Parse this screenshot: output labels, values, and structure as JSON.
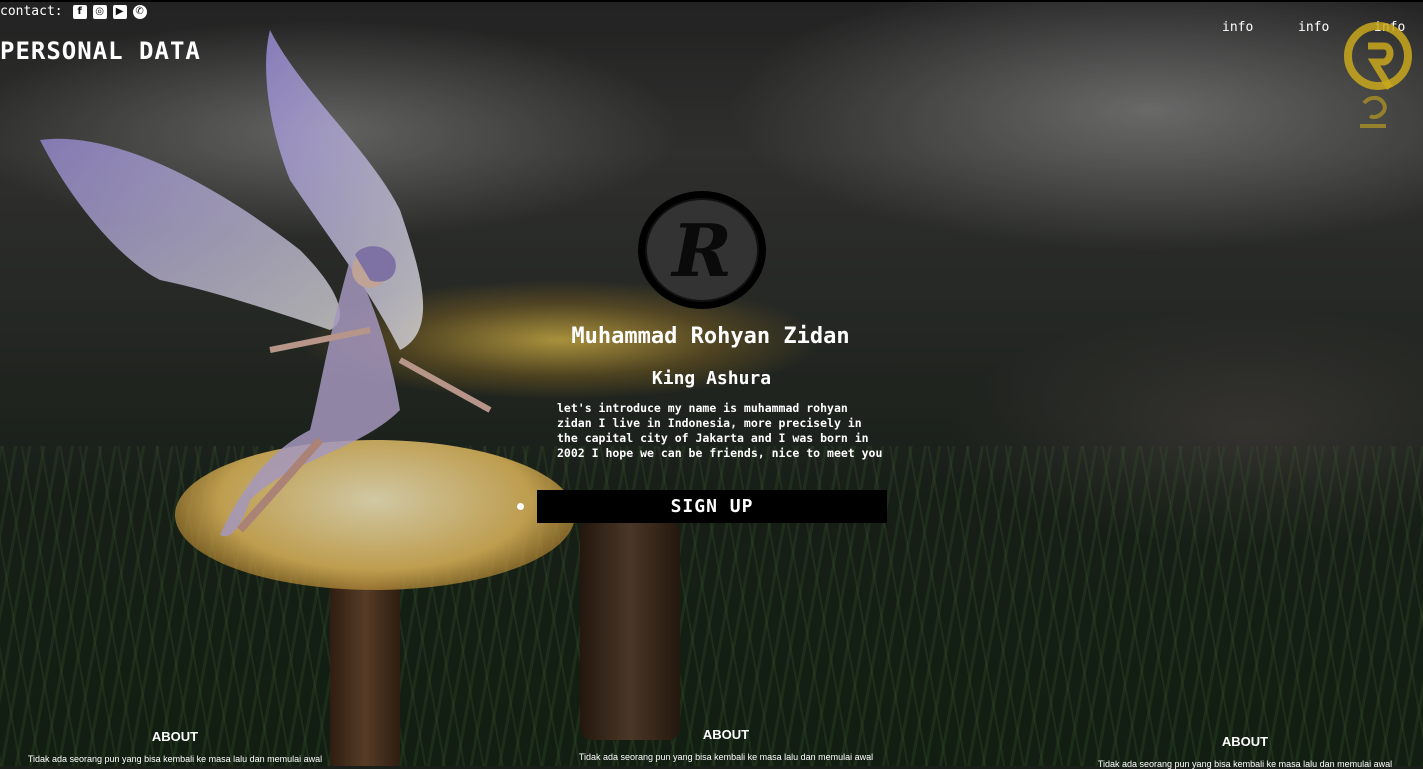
{
  "header": {
    "contact_label": "contact:",
    "social_icons": [
      {
        "name": "facebook-icon",
        "glyph": "f"
      },
      {
        "name": "instagram-icon",
        "glyph": "◎"
      },
      {
        "name": "youtube-icon",
        "glyph": "▶"
      },
      {
        "name": "whatsapp-icon",
        "glyph": "✆"
      }
    ],
    "site_title": "PERSONAL DATA",
    "nav": [
      "info",
      "info",
      "info"
    ]
  },
  "profile": {
    "name": "Muhammad Rohyan Zidan",
    "nickname": "King Ashura",
    "intro": "let's introduce my name is muhammad rohyan zidan I live in Indonesia, more precisely in the capital city of Jakarta and I was born in 2002 I hope we can be friends, nice to meet you",
    "signup_label": "SIGN UP",
    "avatar_letter": "R"
  },
  "about": [
    {
      "title": "ABOUT",
      "text": "Tidak ada seorang pun yang bisa kembali ke masa lalu dan memulai awal"
    },
    {
      "title": "ABOUT",
      "text": "Tidak ada seorang pun yang bisa kembali ke masa lalu dan memulai awal"
    },
    {
      "title": "ABOUT",
      "text": "Tidak ada seorang pun yang bisa kembali ke masa lalu dan memulai awal"
    }
  ],
  "colors": {
    "accent_gold": "#d6b520",
    "button_bg": "#000000",
    "text": "#ffffff"
  }
}
